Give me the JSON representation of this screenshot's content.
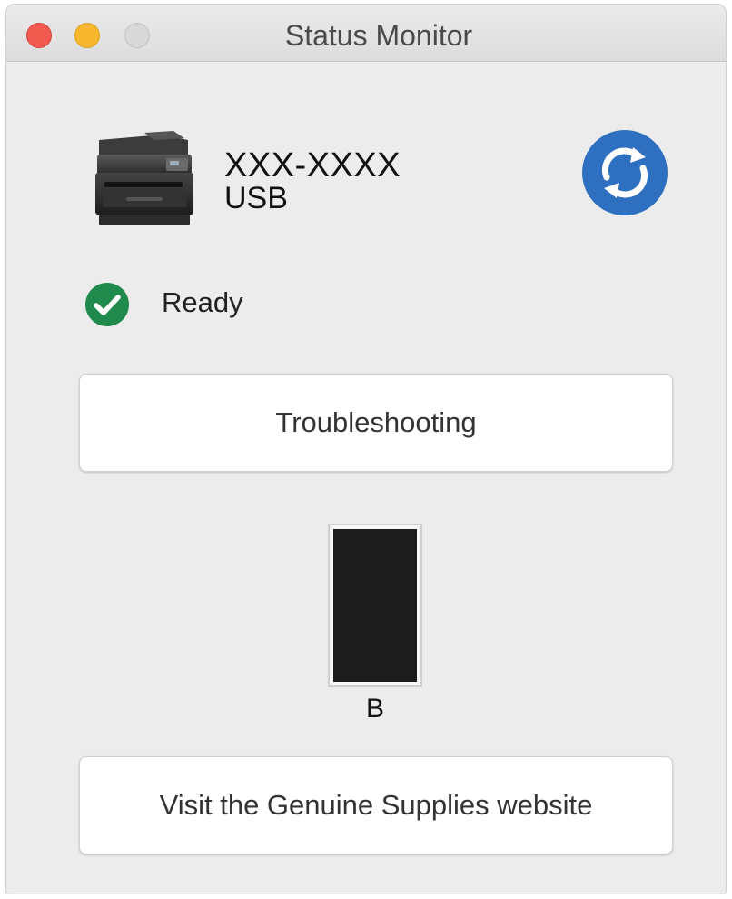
{
  "window": {
    "title": "Status Monitor"
  },
  "device": {
    "name": "XXX-XXXX",
    "connection": "USB",
    "icon": "printer-icon"
  },
  "status": {
    "icon": "checkmark-icon",
    "text": "Ready",
    "color": "#1f8a4c"
  },
  "buttons": {
    "troubleshooting": "Troubleshooting",
    "supplies": "Visit the Genuine Supplies website"
  },
  "toner": {
    "label": "B",
    "level": 1.0,
    "color": "#1c1c1c"
  },
  "colors": {
    "refresh": "#2f6fc0",
    "close": "#f05a4f",
    "minimize": "#f7b72e",
    "zoom": "#d8d8d8"
  }
}
